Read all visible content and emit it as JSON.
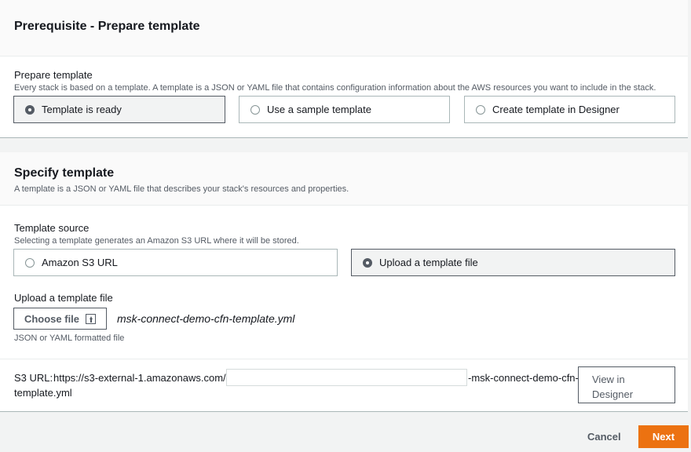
{
  "prerequisite": {
    "title": "Prerequisite - Prepare template",
    "field_label": "Prepare template",
    "field_desc": "Every stack is based on a template. A template is a JSON or YAML file that contains configuration information about the AWS resources you want to include in the stack.",
    "options": [
      {
        "label": "Template is ready",
        "selected": true
      },
      {
        "label": "Use a sample template",
        "selected": false
      },
      {
        "label": "Create template in Designer",
        "selected": false
      }
    ]
  },
  "specify": {
    "title": "Specify template",
    "desc": "A template is a JSON or YAML file that describes your stack's resources and properties.",
    "source_label": "Template source",
    "source_desc": "Selecting a template generates an Amazon S3 URL where it will be stored.",
    "source_options": [
      {
        "label": "Amazon S3 URL",
        "selected": false
      },
      {
        "label": "Upload a template file",
        "selected": true
      }
    ],
    "upload_label": "Upload a template file",
    "choose_file_label": "Choose file",
    "file_name": "msk-connect-demo-cfn-template.yml",
    "upload_hint": "JSON or YAML formatted file",
    "s3_label": "S3 URL:",
    "s3_url_start": "https://s3-external-1.amazonaws.com/c",
    "s3_url_end": "-msk-connect-demo-cfn-",
    "s3_url_line2": "template.yml",
    "view_designer_line1": "View in",
    "view_designer_line2": "Designer"
  },
  "footer": {
    "cancel_label": "Cancel",
    "next_label": "Next"
  },
  "colors": {
    "primary_button": "#ec7211",
    "page_background": "#f2f3f3"
  }
}
